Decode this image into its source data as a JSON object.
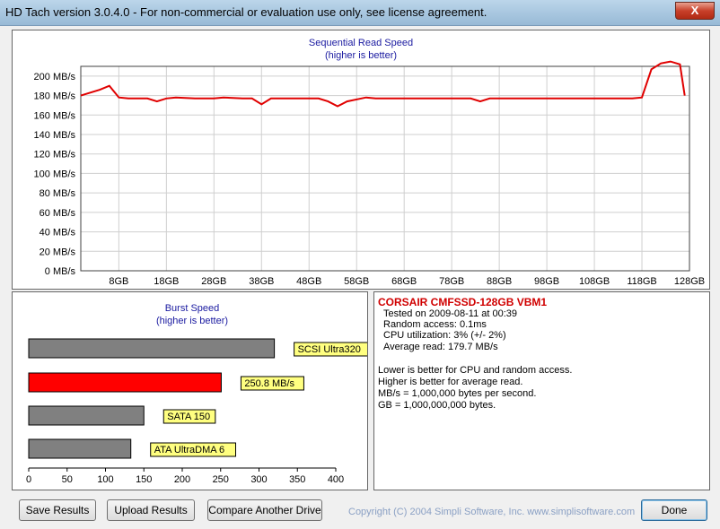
{
  "window": {
    "title": "HD Tach version 3.0.4.0  - For non-commercial or evaluation use only, see license agreement.",
    "close_glyph": "X"
  },
  "read_chart": {
    "title": "Sequential Read Speed",
    "subtitle": "(higher is better)",
    "y_labels": [
      "0 MB/s",
      "20 MB/s",
      "40 MB/s",
      "60 MB/s",
      "80 MB/s",
      "100 MB/s",
      "120 MB/s",
      "140 MB/s",
      "160 MB/s",
      "180 MB/s",
      "200 MB/s"
    ],
    "x_labels": [
      "8GB",
      "18GB",
      "28GB",
      "38GB",
      "48GB",
      "58GB",
      "68GB",
      "78GB",
      "88GB",
      "98GB",
      "108GB",
      "118GB",
      "128GB"
    ],
    "line_color": "#e00000"
  },
  "burst_chart": {
    "title": "Burst Speed",
    "subtitle": "(higher is better)",
    "x_ticks": [
      "0",
      "50",
      "100",
      "150",
      "200",
      "250",
      "300",
      "350",
      "400"
    ]
  },
  "chart_data": [
    {
      "type": "line",
      "title": "Sequential Read Speed",
      "subtitle": "(higher is better)",
      "xlabel": "",
      "ylabel": "",
      "ylim": [
        0,
        210
      ],
      "xlim": [
        0,
        128
      ],
      "grid": true,
      "series": [
        {
          "x": [
            0,
            2,
            4,
            6,
            8,
            10,
            14,
            16,
            18,
            20,
            24,
            28,
            30,
            34,
            36,
            38,
            40,
            42,
            46,
            48,
            50,
            52,
            54,
            56,
            60,
            62,
            66,
            70,
            74,
            78,
            82,
            84,
            86,
            88,
            90,
            94,
            98,
            102,
            106,
            110,
            112,
            114,
            116,
            118,
            120,
            122,
            124,
            126,
            127
          ],
          "y": [
            180,
            183,
            186,
            190,
            178,
            177,
            177,
            174,
            177,
            178,
            177,
            177,
            178,
            177,
            177,
            171,
            177,
            177,
            177,
            177,
            177,
            174,
            169,
            174,
            178,
            177,
            177,
            177,
            177,
            177,
            177,
            174,
            177,
            177,
            177,
            177,
            177,
            177,
            177,
            177,
            177,
            177,
            177,
            178,
            207,
            213,
            215,
            212,
            180
          ]
        }
      ]
    },
    {
      "type": "bar",
      "title": "Burst Speed",
      "subtitle": "(higher is better)",
      "categories": [
        "SCSI Ultra320",
        "250.8 MB/s",
        "SATA 150",
        "ATA UltraDMA 6"
      ],
      "values": [
        320,
        250.8,
        150,
        133
      ],
      "colors": [
        "#808080",
        "#ff0000",
        "#808080",
        "#808080"
      ],
      "xlim": [
        0,
        400
      ]
    }
  ],
  "info": {
    "drive_name": "CORSAIR CMFSSD-128GB VBM1",
    "tested_on": "Tested on 2009-08-11 at 00:39",
    "random_access": "Random access: 0.1ms",
    "cpu_util": "CPU utilization: 3% (+/- 2%)",
    "avg_read": "Average read: 179.7 MB/s",
    "note1": "Lower is better for CPU and random access.",
    "note2": "Higher is better for average read.",
    "note3": "MB/s = 1,000,000 bytes per second.",
    "note4": "GB = 1,000,000,000 bytes."
  },
  "buttons": {
    "save": "Save Results",
    "upload": "Upload Results",
    "compare": "Compare Another Drive",
    "done": "Done"
  },
  "footer": {
    "copyright": "Copyright (C) 2004 Simpli Software, Inc. www.simplisoftware.com"
  }
}
